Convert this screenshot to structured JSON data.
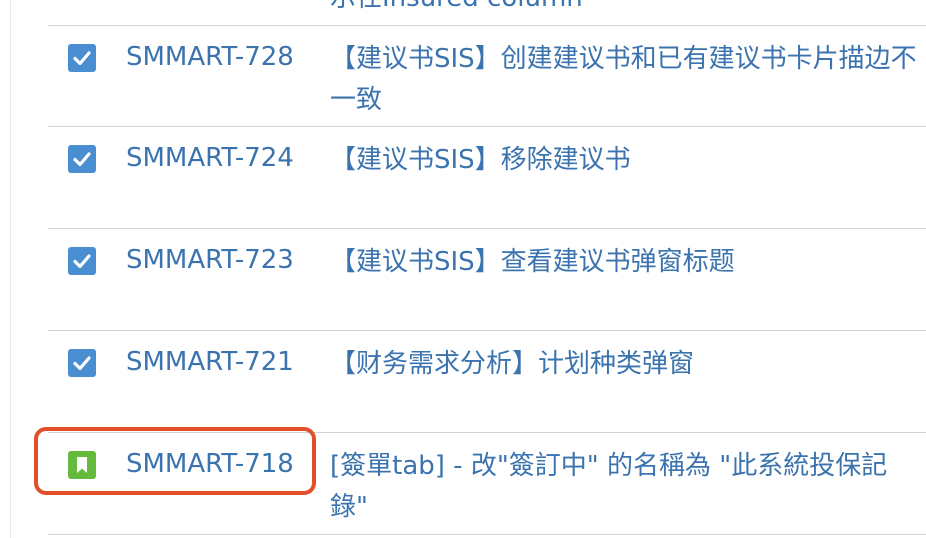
{
  "partial_top_summary": "示任Insured column",
  "issues": [
    {
      "type": "task-icon",
      "key": "SMMART-728",
      "summary": "【建议书SIS】创建建议书和已有建议书卡片描边不一致"
    },
    {
      "type": "task-icon",
      "key": "SMMART-724",
      "summary": "【建议书SIS】移除建议书"
    },
    {
      "type": "task-icon",
      "key": "SMMART-723",
      "summary": "【建议书SIS】查看建议书弹窗标题"
    },
    {
      "type": "task-icon",
      "key": "SMMART-721",
      "summary": "【财务需求分析】计划种类弹窗"
    },
    {
      "type": "story-icon",
      "key": "SMMART-718",
      "summary": "[簽單tab] - 改\"簽訂中\" 的名稱為 \"此系統投保記錄\""
    }
  ],
  "colors": {
    "link": "#3b73af",
    "task_icon": "#4a8ed2",
    "story_icon": "#63ba3c",
    "highlight": "#e0502a",
    "divider": "#cfd4db"
  }
}
